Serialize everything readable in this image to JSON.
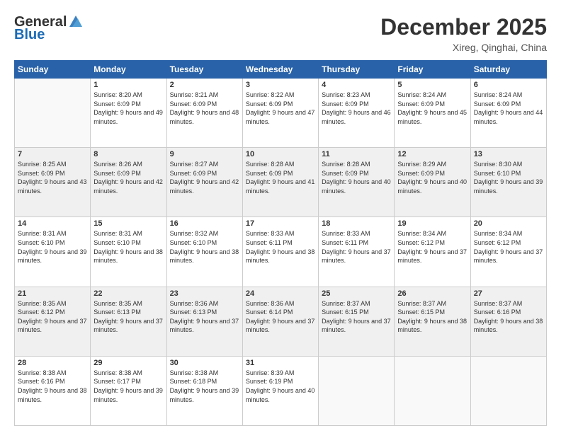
{
  "logo": {
    "general": "General",
    "blue": "Blue"
  },
  "header": {
    "month": "December 2025",
    "location": "Xireg, Qinghai, China"
  },
  "weekdays": [
    "Sunday",
    "Monday",
    "Tuesday",
    "Wednesday",
    "Thursday",
    "Friday",
    "Saturday"
  ],
  "weeks": [
    [
      {
        "day": "",
        "sunrise": "",
        "sunset": "",
        "daylight": ""
      },
      {
        "day": "1",
        "sunrise": "8:20 AM",
        "sunset": "6:09 PM",
        "daylight": "9 hours and 49 minutes."
      },
      {
        "day": "2",
        "sunrise": "8:21 AM",
        "sunset": "6:09 PM",
        "daylight": "9 hours and 48 minutes."
      },
      {
        "day": "3",
        "sunrise": "8:22 AM",
        "sunset": "6:09 PM",
        "daylight": "9 hours and 47 minutes."
      },
      {
        "day": "4",
        "sunrise": "8:23 AM",
        "sunset": "6:09 PM",
        "daylight": "9 hours and 46 minutes."
      },
      {
        "day": "5",
        "sunrise": "8:24 AM",
        "sunset": "6:09 PM",
        "daylight": "9 hours and 45 minutes."
      },
      {
        "day": "6",
        "sunrise": "8:24 AM",
        "sunset": "6:09 PM",
        "daylight": "9 hours and 44 minutes."
      }
    ],
    [
      {
        "day": "7",
        "sunrise": "8:25 AM",
        "sunset": "6:09 PM",
        "daylight": "9 hours and 43 minutes."
      },
      {
        "day": "8",
        "sunrise": "8:26 AM",
        "sunset": "6:09 PM",
        "daylight": "9 hours and 42 minutes."
      },
      {
        "day": "9",
        "sunrise": "8:27 AM",
        "sunset": "6:09 PM",
        "daylight": "9 hours and 42 minutes."
      },
      {
        "day": "10",
        "sunrise": "8:28 AM",
        "sunset": "6:09 PM",
        "daylight": "9 hours and 41 minutes."
      },
      {
        "day": "11",
        "sunrise": "8:28 AM",
        "sunset": "6:09 PM",
        "daylight": "9 hours and 40 minutes."
      },
      {
        "day": "12",
        "sunrise": "8:29 AM",
        "sunset": "6:09 PM",
        "daylight": "9 hours and 40 minutes."
      },
      {
        "day": "13",
        "sunrise": "8:30 AM",
        "sunset": "6:10 PM",
        "daylight": "9 hours and 39 minutes."
      }
    ],
    [
      {
        "day": "14",
        "sunrise": "8:31 AM",
        "sunset": "6:10 PM",
        "daylight": "9 hours and 39 minutes."
      },
      {
        "day": "15",
        "sunrise": "8:31 AM",
        "sunset": "6:10 PM",
        "daylight": "9 hours and 38 minutes."
      },
      {
        "day": "16",
        "sunrise": "8:32 AM",
        "sunset": "6:10 PM",
        "daylight": "9 hours and 38 minutes."
      },
      {
        "day": "17",
        "sunrise": "8:33 AM",
        "sunset": "6:11 PM",
        "daylight": "9 hours and 38 minutes."
      },
      {
        "day": "18",
        "sunrise": "8:33 AM",
        "sunset": "6:11 PM",
        "daylight": "9 hours and 37 minutes."
      },
      {
        "day": "19",
        "sunrise": "8:34 AM",
        "sunset": "6:12 PM",
        "daylight": "9 hours and 37 minutes."
      },
      {
        "day": "20",
        "sunrise": "8:34 AM",
        "sunset": "6:12 PM",
        "daylight": "9 hours and 37 minutes."
      }
    ],
    [
      {
        "day": "21",
        "sunrise": "8:35 AM",
        "sunset": "6:12 PM",
        "daylight": "9 hours and 37 minutes."
      },
      {
        "day": "22",
        "sunrise": "8:35 AM",
        "sunset": "6:13 PM",
        "daylight": "9 hours and 37 minutes."
      },
      {
        "day": "23",
        "sunrise": "8:36 AM",
        "sunset": "6:13 PM",
        "daylight": "9 hours and 37 minutes."
      },
      {
        "day": "24",
        "sunrise": "8:36 AM",
        "sunset": "6:14 PM",
        "daylight": "9 hours and 37 minutes."
      },
      {
        "day": "25",
        "sunrise": "8:37 AM",
        "sunset": "6:15 PM",
        "daylight": "9 hours and 37 minutes."
      },
      {
        "day": "26",
        "sunrise": "8:37 AM",
        "sunset": "6:15 PM",
        "daylight": "9 hours and 38 minutes."
      },
      {
        "day": "27",
        "sunrise": "8:37 AM",
        "sunset": "6:16 PM",
        "daylight": "9 hours and 38 minutes."
      }
    ],
    [
      {
        "day": "28",
        "sunrise": "8:38 AM",
        "sunset": "6:16 PM",
        "daylight": "9 hours and 38 minutes."
      },
      {
        "day": "29",
        "sunrise": "8:38 AM",
        "sunset": "6:17 PM",
        "daylight": "9 hours and 39 minutes."
      },
      {
        "day": "30",
        "sunrise": "8:38 AM",
        "sunset": "6:18 PM",
        "daylight": "9 hours and 39 minutes."
      },
      {
        "day": "31",
        "sunrise": "8:39 AM",
        "sunset": "6:19 PM",
        "daylight": "9 hours and 40 minutes."
      },
      {
        "day": "",
        "sunrise": "",
        "sunset": "",
        "daylight": ""
      },
      {
        "day": "",
        "sunrise": "",
        "sunset": "",
        "daylight": ""
      },
      {
        "day": "",
        "sunrise": "",
        "sunset": "",
        "daylight": ""
      }
    ]
  ]
}
